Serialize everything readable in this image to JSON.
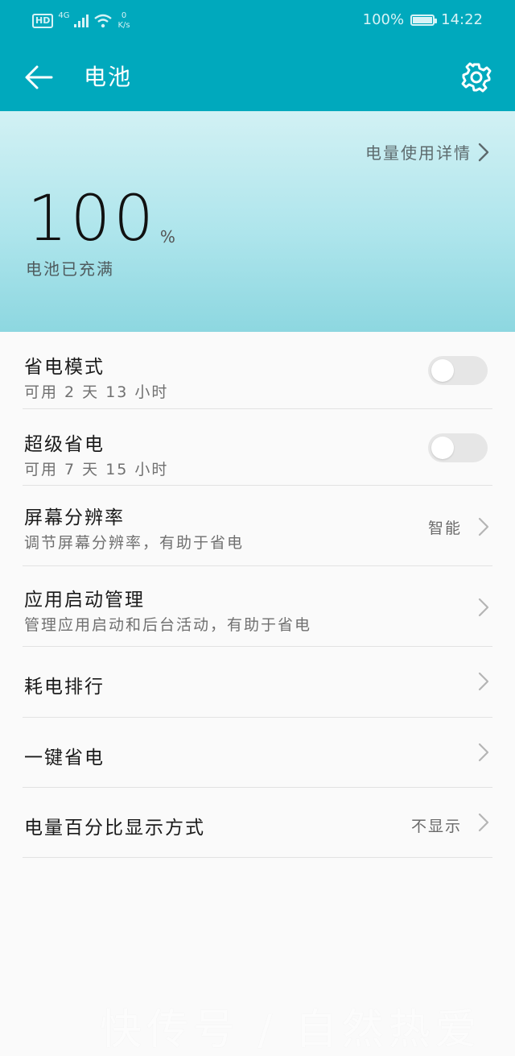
{
  "status_bar": {
    "hd": "HD",
    "network": "4G",
    "speed_value": "0",
    "speed_unit": "K/s",
    "battery_percent": "100%",
    "time": "14:22"
  },
  "header": {
    "title": "电池",
    "back_icon": "arrow-left-icon",
    "settings_icon": "gear-icon"
  },
  "hero": {
    "usage_link": "电量使用详情",
    "battery_value": "100",
    "battery_unit": "%",
    "battery_status": "电池已充满"
  },
  "settings": [
    {
      "title": "省电模式",
      "subtitle": "可用 2 天 13 小时",
      "control": "toggle",
      "on": false
    },
    {
      "title": "超级省电",
      "subtitle": "可用 7 天 15 小时",
      "control": "toggle",
      "on": false
    },
    {
      "title": "屏幕分辨率",
      "subtitle": "调节屏幕分辨率，有助于省电",
      "value": "智能",
      "control": "chevron"
    },
    {
      "title": "应用启动管理",
      "subtitle": "管理应用启动和后台活动，有助于省电",
      "control": "chevron"
    },
    {
      "title": "耗电排行",
      "control": "chevron"
    },
    {
      "title": "一键省电",
      "control": "chevron"
    },
    {
      "title": "电量百分比显示方式",
      "value": "不显示",
      "control": "chevron"
    }
  ],
  "watermark": "快传号 / 自然热爱",
  "colors": {
    "accent": "#00a9bd",
    "toggle_off": "#e6e6e6"
  }
}
